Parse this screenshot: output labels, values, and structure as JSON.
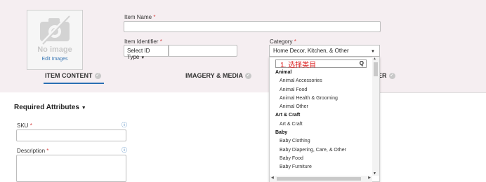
{
  "image": {
    "no_image_text": "No image",
    "edit_label": "Edit Images"
  },
  "item_name": {
    "label": "Item Name",
    "required": "*",
    "value": ""
  },
  "item_identifier": {
    "label": "Item Identifier",
    "required": "*",
    "select_label": "Select ID Type",
    "value": ""
  },
  "category": {
    "label": "Category",
    "required": "*",
    "selected": "Home Decor, Kitchen, & Other",
    "search_value": "1. 选择类目",
    "options": [
      {
        "label": "Animal",
        "group": true
      },
      {
        "label": "Animal Accessories",
        "group": false
      },
      {
        "label": "Animal Food",
        "group": false
      },
      {
        "label": "Animal Health & Grooming",
        "group": false
      },
      {
        "label": "Animal Other",
        "group": false
      },
      {
        "label": "Art & Craft",
        "group": true
      },
      {
        "label": "Art & Craft",
        "group": false
      },
      {
        "label": "Baby",
        "group": true
      },
      {
        "label": "Baby Clothing",
        "group": false
      },
      {
        "label": "Baby Diapering, Care, & Other",
        "group": false
      },
      {
        "label": "Baby Food",
        "group": false
      },
      {
        "label": "Baby Furniture",
        "group": false
      }
    ]
  },
  "tabs": [
    {
      "label": "ITEM CONTENT",
      "active": true
    },
    {
      "label": "IMAGERY & MEDIA",
      "active": false
    },
    {
      "label": "ER",
      "active": false
    }
  ],
  "section": {
    "title": "Required Attributes",
    "caret": "▼"
  },
  "sku": {
    "label": "SKU",
    "required": "*",
    "info": "ⓘ",
    "value": ""
  },
  "description": {
    "label": "Description",
    "required": "*",
    "info": "ⓘ",
    "value": ""
  },
  "colors": {
    "accent": "#2a6fb3",
    "required": "#d64545",
    "header_bg": "#f5eef1"
  },
  "icons": {
    "image_placeholder": "camera-off-icon",
    "search": "search-icon",
    "check": "check-circle-icon"
  }
}
